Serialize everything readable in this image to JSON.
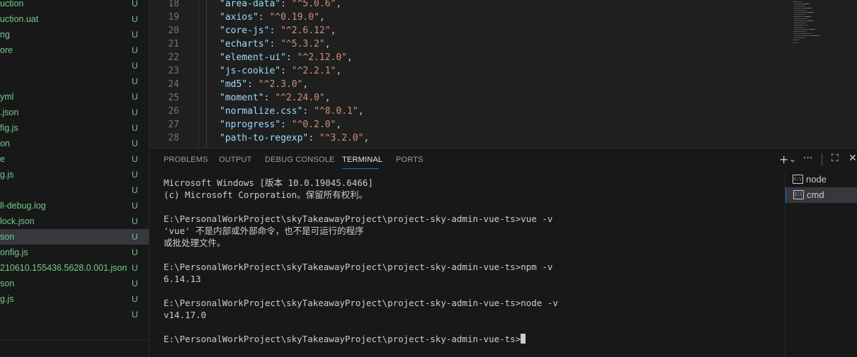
{
  "explorer": {
    "files": [
      {
        "name": "uction",
        "status": "U"
      },
      {
        "name": "uction.uat",
        "status": "U"
      },
      {
        "name": "ng",
        "status": "U"
      },
      {
        "name": "ore",
        "status": "U"
      },
      {
        "name": "",
        "status": "U"
      },
      {
        "name": "",
        "status": "U"
      },
      {
        "name": "yml",
        "status": "U"
      },
      {
        "name": ".json",
        "status": "U"
      },
      {
        "name": "fig.js",
        "status": "U"
      },
      {
        "name": "on",
        "status": "U"
      },
      {
        "name": "e",
        "status": "U"
      },
      {
        "name": "g.js",
        "status": "U"
      },
      {
        "name": "",
        "status": "U"
      },
      {
        "name": "ll-debug.log",
        "status": "U"
      },
      {
        "name": "lock.json",
        "status": "U"
      },
      {
        "name": "son",
        "status": "U"
      },
      {
        "name": "onfig.js",
        "status": "U"
      },
      {
        "name": "210610.155436.5628.0.001.json",
        "status": "U"
      },
      {
        "name": "son",
        "status": "U"
      },
      {
        "name": "g.js",
        "status": "U"
      },
      {
        "name": "",
        "status": "U"
      }
    ]
  },
  "editor": {
    "lines": [
      {
        "num": "18",
        "key": "\"area-data\"",
        "value": "\"^5.0.6\""
      },
      {
        "num": "19",
        "key": "\"axios\"",
        "value": "\"^0.19.0\""
      },
      {
        "num": "20",
        "key": "\"core-js\"",
        "value": "\"^2.6.12\""
      },
      {
        "num": "21",
        "key": "\"echarts\"",
        "value": "\"^5.3.2\""
      },
      {
        "num": "22",
        "key": "\"element-ui\"",
        "value": "\"^2.12.0\""
      },
      {
        "num": "23",
        "key": "\"js-cookie\"",
        "value": "\"^2.2.1\""
      },
      {
        "num": "24",
        "key": "\"md5\"",
        "value": "\"^2.3.0\""
      },
      {
        "num": "25",
        "key": "\"moment\"",
        "value": "\"^2.24.0\""
      },
      {
        "num": "26",
        "key": "\"normalize.css\"",
        "value": "\"^8.0.1\""
      },
      {
        "num": "27",
        "key": "\"nprogress\"",
        "value": "\"^0.2.0\""
      },
      {
        "num": "28",
        "key": "\"path-to-regexp\"",
        "value": "\"^3.2.0\""
      }
    ]
  },
  "panel": {
    "tabs": [
      {
        "label": "PROBLEMS"
      },
      {
        "label": "OUTPUT"
      },
      {
        "label": "DEBUG CONSOLE"
      },
      {
        "label": "TERMINAL",
        "active": true
      },
      {
        "label": "PORTS"
      }
    ],
    "actions": {
      "add": "+",
      "dropdown": "⌄",
      "more": "···",
      "maximize": "⛶"
    },
    "terminal_lines": [
      "Microsoft Windows [版本 10.0.19045.6466]",
      "(c) Microsoft Corporation。保留所有权利。",
      "",
      "E:\\PersonalWorkProject\\skyTakeawayProject\\project-sky-admin-vue-ts>vue -v",
      "'vue' 不是内部或外部命令，也不是可运行的程序",
      "或批处理文件。",
      "",
      "E:\\PersonalWorkProject\\skyTakeawayProject\\project-sky-admin-vue-ts>npm -v",
      "6.14.13",
      "",
      "E:\\PersonalWorkProject\\skyTakeawayProject\\project-sky-admin-vue-ts>node -v",
      "v14.17.0",
      "",
      "E:\\PersonalWorkProject\\skyTakeawayProject\\project-sky-admin-vue-ts>"
    ],
    "terminals": [
      {
        "label": "node",
        "icon_text": "C:\\"
      },
      {
        "label": "cmd",
        "icon_text": "C:\\",
        "active": true
      }
    ]
  },
  "colors": {
    "accent": "#0078d4",
    "untracked": "#73c991",
    "json_key": "#9cdcfe",
    "json_string": "#ce9178"
  }
}
